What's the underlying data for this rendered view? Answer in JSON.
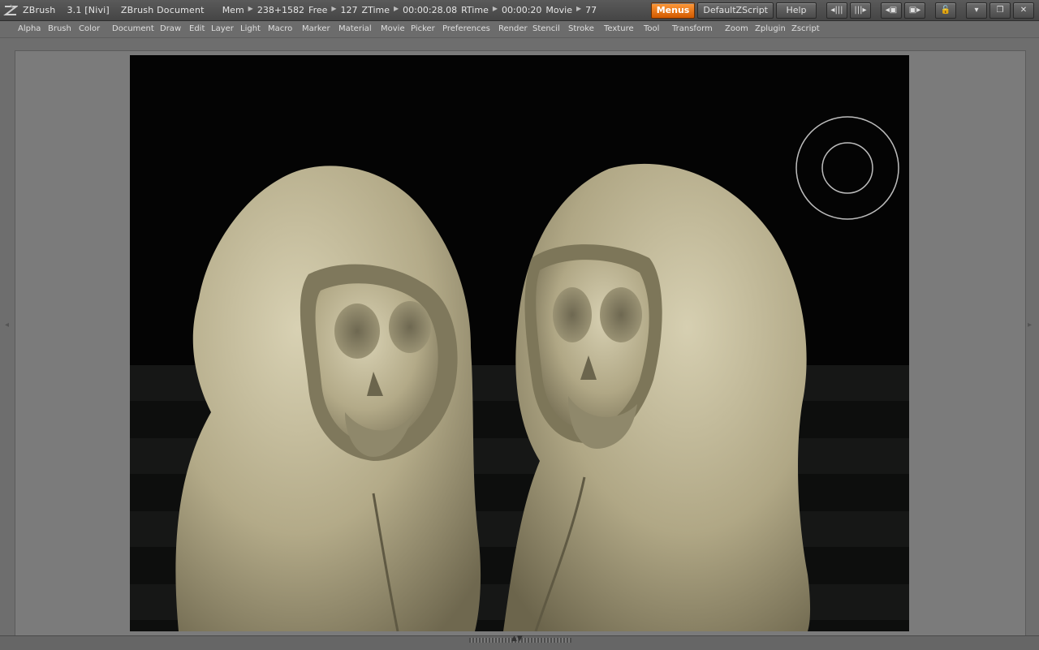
{
  "titlebar": {
    "app_name": "ZBrush",
    "version": "3.1 [Nivi]",
    "document": "ZBrush Document",
    "mem_label": "Mem",
    "mem_value": "238+1582",
    "free_label": "Free",
    "free_value": "127",
    "ztime_label": "ZTime",
    "ztime_value": "00:00:28.08",
    "rtime_label": "RTime",
    "rtime_value": "00:00:20",
    "movie_label": "Movie",
    "movie_value": "77",
    "menus_button": "Menus",
    "script_button": "DefaultZScript",
    "help_button": "Help"
  },
  "menu": {
    "items": [
      "Alpha",
      "Brush",
      "Color",
      "Document",
      "Draw",
      "Edit",
      "Layer",
      "Light",
      "Macro",
      "Marker",
      "Material",
      "Movie",
      "Picker",
      "Preferences",
      "Render",
      "Stencil",
      "Stroke",
      "Texture",
      "Tool",
      "Transform",
      "Zoom",
      "Zplugin",
      "Zscript"
    ]
  },
  "colors": {
    "menus_accent": "#ff7a10",
    "sculpt_clay": "#c9c1a2",
    "canvas_bg": "#040404"
  }
}
